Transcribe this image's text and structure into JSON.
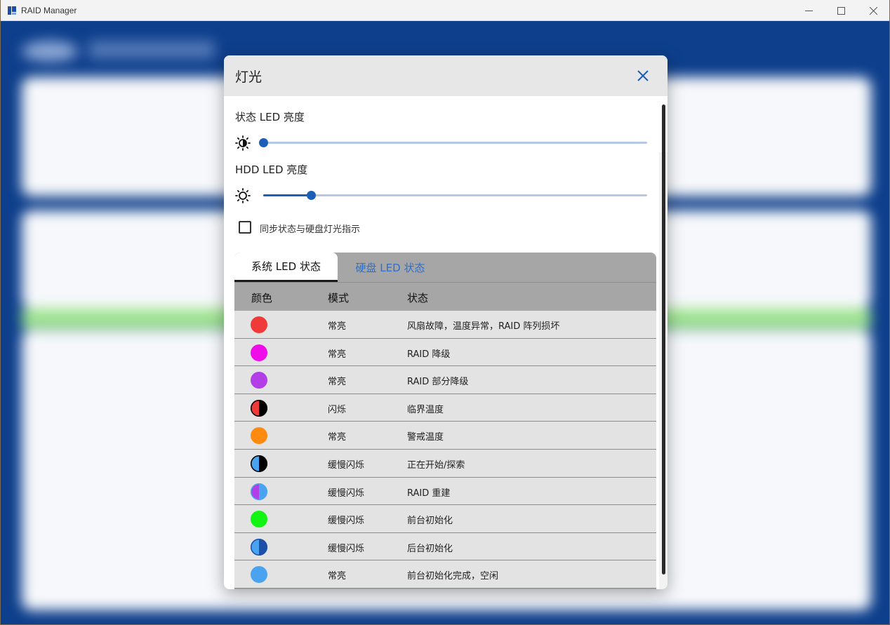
{
  "window": {
    "title": "RAID Manager",
    "controls": {
      "minimize": "minimize-icon",
      "maximize": "maximize-icon",
      "close": "close-icon"
    }
  },
  "dialog": {
    "title": "灯光",
    "status_led": {
      "label": "状态 LED 亮度",
      "value_percent": 0
    },
    "hdd_led": {
      "label": "HDD LED 亮度",
      "value_percent": 12.5
    },
    "sync": {
      "label": "同步状态与硬盘灯光指示",
      "checked": false
    },
    "tabs": [
      {
        "label": "系统 LED 状态",
        "active": true
      },
      {
        "label": "硬盘 LED 状态",
        "active": false
      }
    ],
    "table": {
      "headers": [
        "颜色",
        "模式",
        "状态"
      ],
      "rows": [
        {
          "color": "#f03a3a",
          "color2": "",
          "mode": "常亮",
          "state": "风扇故障，温度异常，RAID 阵列损坏"
        },
        {
          "color": "#f00ce8",
          "color2": "",
          "mode": "常亮",
          "state": "RAID 降级"
        },
        {
          "color": "#b13ee6",
          "color2": "",
          "mode": "常亮",
          "state": "RAID 部分降级"
        },
        {
          "color": "#f03a3a",
          "color2": "#000000",
          "mode": "闪烁",
          "state": "临界温度"
        },
        {
          "color": "#ff8a10",
          "color2": "",
          "mode": "常亮",
          "state": "警戒温度"
        },
        {
          "color": "#49a3f0",
          "color2": "#000000",
          "mode": "缓慢闪烁",
          "state": "正在开始/探索"
        },
        {
          "color": "#b13ee6",
          "color2": "#49a3f0",
          "mode": "缓慢闪烁",
          "state": "RAID 重建"
        },
        {
          "color": "#12f412",
          "color2": "",
          "mode": "缓慢闪烁",
          "state": "前台初始化"
        },
        {
          "color": "#49a3f0",
          "color2": "#1d4fa8",
          "mode": "缓慢闪烁",
          "state": "后台初始化"
        },
        {
          "color": "#49a3f0",
          "color2": "",
          "mode": "常亮",
          "state": "前台初始化完成，空闲"
        }
      ]
    }
  },
  "colors": {
    "accent": "#1d5fb7",
    "background": "#0e3f8c",
    "header_bg": "#e7e7e7",
    "table_header_bg": "#a6a6a6"
  }
}
